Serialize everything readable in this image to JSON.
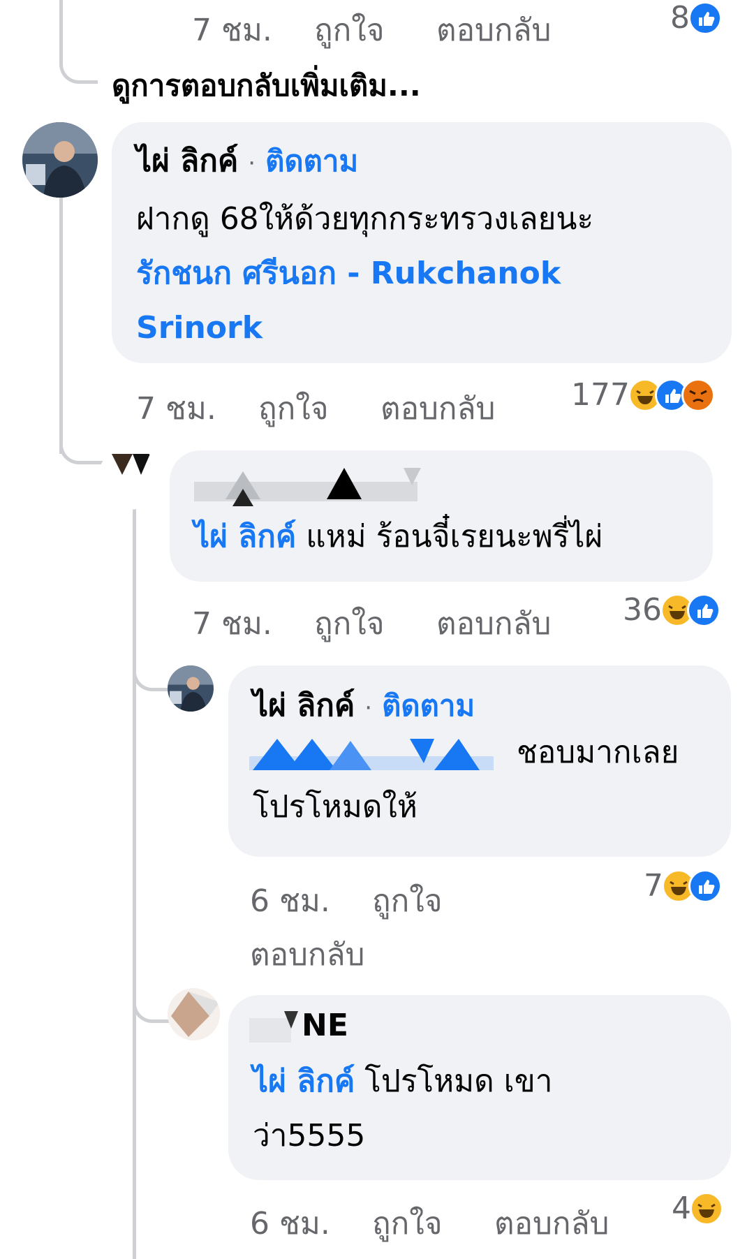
{
  "top_reply": {
    "time": "7 ชม.",
    "like": "ถูกใจ",
    "reply": "ตอบกลับ",
    "reaction_count": "8",
    "reactions": [
      "like"
    ]
  },
  "see_more": "ดูการตอบกลับเพิ่มเติม...",
  "comment1": {
    "author": "ไผ่ ลิกค์",
    "follow": "ติดตาม",
    "separator": "·",
    "text": "ฝากดู 68ให้ด้วยทุกกระทรวงเลยนะ",
    "mention_line1": "รักชนก ศรีนอก - Rukchanok",
    "mention_line2": "Srinork",
    "time": "7 ชม.",
    "like": "ถูกใจ",
    "reply": "ตอบกลับ",
    "reaction_count": "177",
    "reactions": [
      "haha",
      "like",
      "angry"
    ]
  },
  "reply1": {
    "mention": "ไผ่ ลิกค์",
    "text": "แหม่ ร้อนจี๋เรยนะพรี่ไผ่",
    "time": "7 ชม.",
    "like": "ถูกใจ",
    "reply": "ตอบกลับ",
    "reaction_count": "36",
    "reactions": [
      "haha",
      "like"
    ]
  },
  "reply2": {
    "author": "ไผ่ ลิกค์",
    "follow": "ติดตาม",
    "separator": "·",
    "text_line1": "ชอบมากเลย",
    "text_line2": "โปรโหมดให้",
    "time": "6 ชม.",
    "like": "ถูกใจ",
    "reply": "ตอบกลับ",
    "reaction_count": "7",
    "reactions": [
      "haha",
      "like"
    ]
  },
  "reply3": {
    "author_partial": "NE",
    "mention": "ไผ่ ลิกค์",
    "text_line1": "โปรโหมด เขา",
    "text_line2": "ว่า5555",
    "time": "6 ชม.",
    "like": "ถูกใจ",
    "reply": "ตอบกลับ",
    "reaction_count": "4",
    "reactions": [
      "haha"
    ]
  },
  "colors": {
    "bubble": "#f0f2f5",
    "link": "#1877f2",
    "meta": "#65676b",
    "thread": "#ced0d4"
  }
}
